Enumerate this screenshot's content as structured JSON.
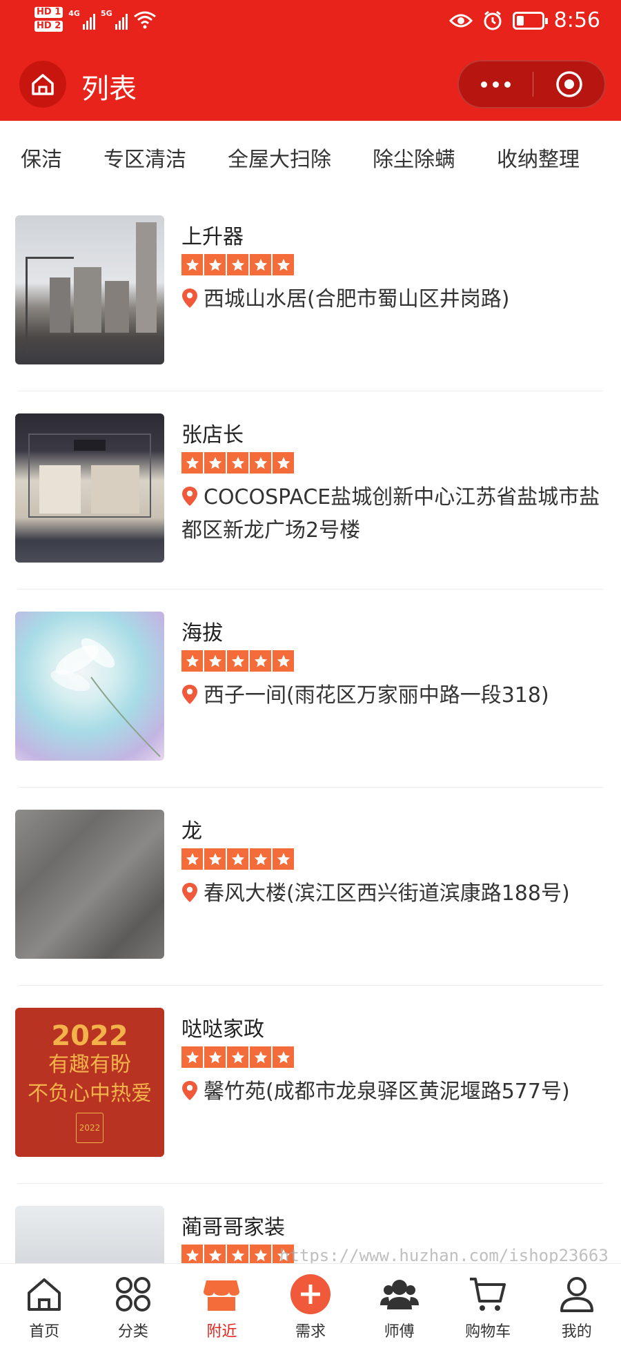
{
  "status_bar": {
    "hd1": "HD 1",
    "hd2": "HD 2",
    "net1": "4G",
    "net2": "5G",
    "time": "8:56"
  },
  "header": {
    "title": "列表"
  },
  "categories": [
    "保洁",
    "专区清洁",
    "全屋大扫除",
    "除尘除螨",
    "收纳整理"
  ],
  "shops": [
    {
      "name": "上升器",
      "rating": 5,
      "address": "西城山水居(合肥市蜀山区井岗路)"
    },
    {
      "name": "张店长",
      "rating": 5,
      "address": "COCOSPACE盐城创新中心江苏省盐城市盐都区新龙广场2号楼"
    },
    {
      "name": "海拔",
      "rating": 5,
      "address": "西子一间(雨花区万家丽中路一段318)"
    },
    {
      "name": "龙",
      "rating": 5,
      "address": "春风大楼(滨江区西兴街道滨康路188号)"
    },
    {
      "name": "哒哒家政",
      "rating": 5,
      "address": "馨竹苑(成都市龙泉驿区黄泥堰路577号)"
    },
    {
      "name": "蔺哥哥家装",
      "rating": 5,
      "address": ""
    }
  ],
  "poster": {
    "year": "2022",
    "line1": "有趣有盼",
    "line2": "不负心中热爱",
    "tag": "2022"
  },
  "watermark": "https://www.huzhan.com/ishop23663",
  "tabbar": [
    {
      "label": "首页",
      "icon": "home-icon"
    },
    {
      "label": "分类",
      "icon": "category-icon"
    },
    {
      "label": "附近",
      "icon": "store-icon",
      "active": true
    },
    {
      "label": "需求",
      "icon": "plus-icon"
    },
    {
      "label": "师傅",
      "icon": "workers-icon"
    },
    {
      "label": "购物车",
      "icon": "cart-icon"
    },
    {
      "label": "我的",
      "icon": "profile-icon"
    }
  ],
  "colors": {
    "brand": "#e8231c",
    "star": "#f36c3a"
  }
}
